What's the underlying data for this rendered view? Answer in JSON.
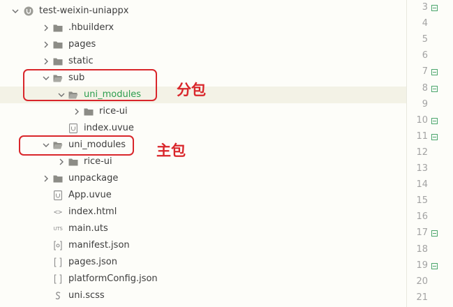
{
  "explorer": {
    "project_name": "test-weixin-uniappx",
    "items": [
      {
        "label": "test-weixin-uniappx",
        "icon": "project-icon",
        "arrow": "down"
      },
      {
        "label": ".hbuilderx",
        "icon": "folder-icon",
        "arrow": "right"
      },
      {
        "label": "pages",
        "icon": "folder-icon",
        "arrow": "right"
      },
      {
        "label": "static",
        "icon": "folder-icon",
        "arrow": "right"
      },
      {
        "label": "sub",
        "icon": "folder-open-icon",
        "arrow": "down"
      },
      {
        "label": "uni_modules",
        "icon": "folder-open-icon",
        "arrow": "down",
        "selected": true
      },
      {
        "label": "rice-ui",
        "icon": "folder-icon",
        "arrow": "right"
      },
      {
        "label": "index.uvue",
        "icon": "uvue-file-icon",
        "arrow": "none"
      },
      {
        "label": "uni_modules",
        "icon": "folder-open-icon",
        "arrow": "down"
      },
      {
        "label": "rice-ui",
        "icon": "folder-icon",
        "arrow": "right"
      },
      {
        "label": "unpackage",
        "icon": "folder-icon",
        "arrow": "right"
      },
      {
        "label": "App.uvue",
        "icon": "uvue-file-icon",
        "arrow": "none"
      },
      {
        "label": "index.html",
        "icon": "html-file-icon",
        "arrow": "none"
      },
      {
        "label": "main.uts",
        "icon": "uts-file-icon",
        "arrow": "none"
      },
      {
        "label": "manifest.json",
        "icon": "manifest-file-icon",
        "arrow": "none"
      },
      {
        "label": "pages.json",
        "icon": "json-file-icon",
        "arrow": "none"
      },
      {
        "label": "platformConfig.json",
        "icon": "json-file-icon",
        "arrow": "none"
      },
      {
        "label": "uni.scss",
        "icon": "scss-file-icon",
        "arrow": "none"
      }
    ]
  },
  "annotations": {
    "sub_package": "分包",
    "main_package": "主包"
  },
  "gutter": {
    "line_numbers": [
      "3",
      "4",
      "5",
      "6",
      "7",
      "8",
      "9",
      "10",
      "11",
      "12",
      "13",
      "14",
      "15",
      "16",
      "17",
      "18",
      "19",
      "20",
      "21"
    ],
    "fold_lines": [
      "3",
      "7",
      "8",
      "10",
      "11",
      "17",
      "19"
    ]
  },
  "colors": {
    "accent_green": "#2c9d4e",
    "annotation_red": "#d9262b",
    "selected_row": "#f3f2e6"
  },
  "uts_icon_text": "UTS"
}
